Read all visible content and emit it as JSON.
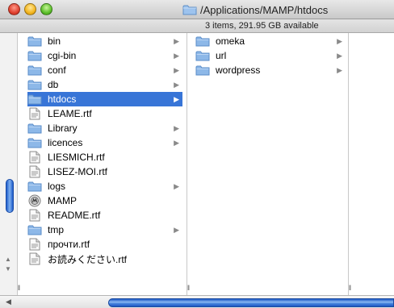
{
  "window": {
    "title": "/Applications/MAMP/htdocs",
    "status": "3 items, 291.95 GB available"
  },
  "column1": {
    "items": [
      {
        "label": "bin",
        "icon": "folder-icon",
        "has_children": true,
        "selected": false
      },
      {
        "label": "cgi-bin",
        "icon": "folder-icon",
        "has_children": true,
        "selected": false
      },
      {
        "label": "conf",
        "icon": "folder-icon",
        "has_children": true,
        "selected": false
      },
      {
        "label": "db",
        "icon": "folder-icon",
        "has_children": true,
        "selected": false
      },
      {
        "label": "htdocs",
        "icon": "folder-icon",
        "has_children": true,
        "selected": true
      },
      {
        "label": "LEAME.rtf",
        "icon": "rtf-document-icon",
        "has_children": false,
        "selected": false
      },
      {
        "label": "Library",
        "icon": "folder-icon",
        "has_children": true,
        "selected": false
      },
      {
        "label": "licences",
        "icon": "folder-icon",
        "has_children": true,
        "selected": false
      },
      {
        "label": "LIESMICH.rtf",
        "icon": "rtf-document-icon",
        "has_children": false,
        "selected": false
      },
      {
        "label": "LISEZ-MOI.rtf",
        "icon": "rtf-document-icon",
        "has_children": false,
        "selected": false
      },
      {
        "label": "logs",
        "icon": "folder-icon",
        "has_children": true,
        "selected": false
      },
      {
        "label": "MAMP",
        "icon": "mamp-app-icon",
        "has_children": false,
        "selected": false
      },
      {
        "label": "README.rtf",
        "icon": "rtf-document-icon",
        "has_children": false,
        "selected": false
      },
      {
        "label": "tmp",
        "icon": "folder-icon",
        "has_children": true,
        "selected": false
      },
      {
        "label": "прочти.rtf",
        "icon": "rtf-document-icon",
        "has_children": false,
        "selected": false
      },
      {
        "label": "お読みください.rtf",
        "icon": "rtf-document-icon",
        "has_children": false,
        "selected": false
      }
    ]
  },
  "column2": {
    "items": [
      {
        "label": "omeka",
        "icon": "folder-icon",
        "has_children": true
      },
      {
        "label": "url",
        "icon": "folder-icon",
        "has_children": true
      },
      {
        "label": "wordpress",
        "icon": "folder-icon",
        "has_children": true
      }
    ]
  },
  "colors": {
    "selection": "#3875d7",
    "folder": "#8db8e8",
    "scroll_thumb": "#4d8ae0"
  }
}
